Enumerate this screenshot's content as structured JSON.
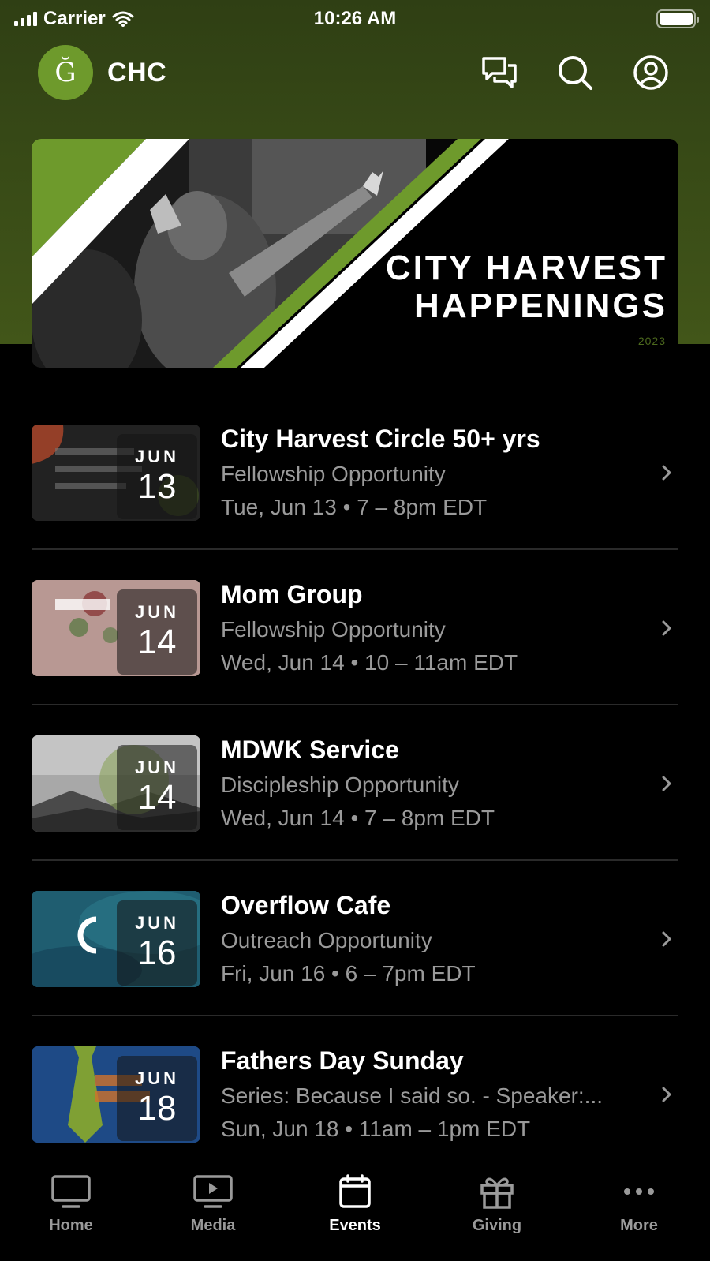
{
  "status_bar": {
    "carrier": "Carrier",
    "time": "10:26 AM",
    "battery_level": 1.0
  },
  "header": {
    "logo_glyph": "Ğ",
    "title": "CHC",
    "icons": [
      "chat-icon",
      "search-icon",
      "profile-icon"
    ]
  },
  "hero": {
    "title_line1": "CITY HARVEST",
    "title_line2": "HAPPENINGS",
    "year": "2023"
  },
  "events": [
    {
      "title": "City Harvest Circle 50+ yrs",
      "category": "Fellowship Opportunity",
      "time": "Tue, Jun 13 • 7 – 8pm EDT",
      "month": "JUN",
      "day": "13"
    },
    {
      "title": "Mom Group",
      "category": "Fellowship Opportunity",
      "time": "Wed, Jun 14 • 10 – 11am EDT",
      "month": "JUN",
      "day": "14"
    },
    {
      "title": "MDWK Service",
      "category": "Discipleship Opportunity",
      "time": "Wed, Jun 14 • 7 – 8pm EDT",
      "month": "JUN",
      "day": "14"
    },
    {
      "title": "Overflow Cafe",
      "category": "Outreach Opportunity",
      "time": "Fri, Jun 16 • 6 – 7pm EDT",
      "month": "JUN",
      "day": "16"
    },
    {
      "title": "Fathers Day Sunday",
      "category": "Series: Because I said so. - Speaker:...",
      "time": "Sun, Jun 18 • 11am – 1pm EDT",
      "month": "JUN",
      "day": "18"
    }
  ],
  "tabs": [
    {
      "label": "Home",
      "icon": "tv-icon",
      "active": false
    },
    {
      "label": "Media",
      "icon": "play-icon",
      "active": false
    },
    {
      "label": "Events",
      "icon": "calendar-icon",
      "active": true
    },
    {
      "label": "Giving",
      "icon": "gift-icon",
      "active": false
    },
    {
      "label": "More",
      "icon": "more-icon",
      "active": false
    }
  ],
  "colors": {
    "accent": "#6e9a2c",
    "header_bg": "#3a4d17",
    "muted_text": "#9a9a9a"
  }
}
